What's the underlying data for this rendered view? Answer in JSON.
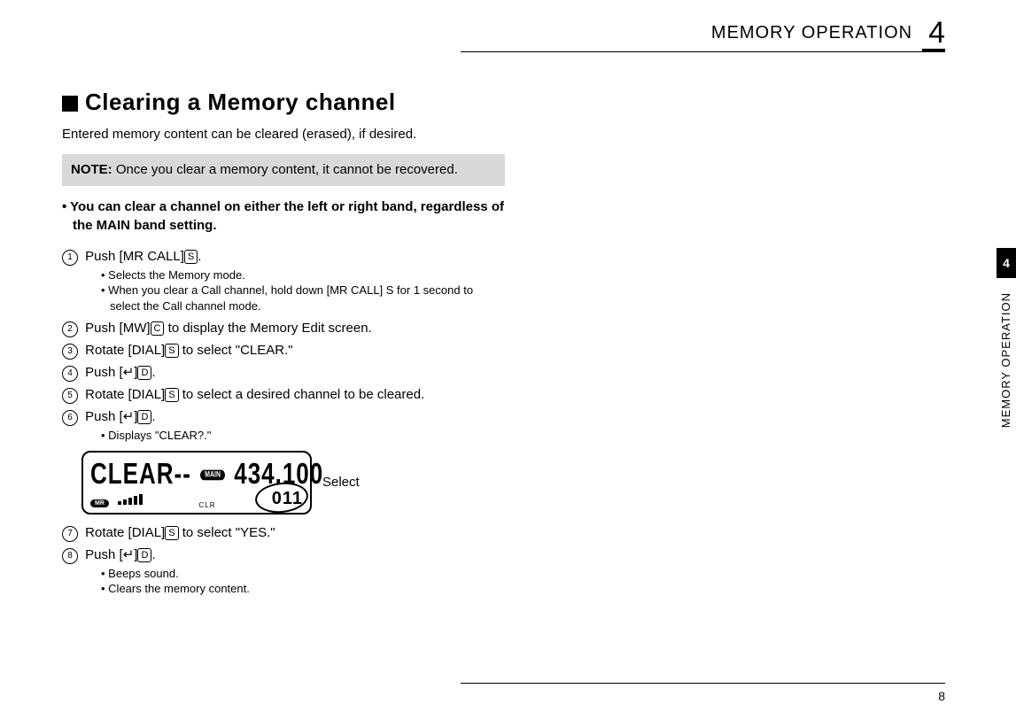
{
  "header": {
    "section_title": "MEMORY OPERATION",
    "chapter_number": "4"
  },
  "side": {
    "tab_number": "4",
    "vertical_label": "MEMORY OPERATION"
  },
  "page_number": "8",
  "content": {
    "title": "Clearing a Memory channel",
    "intro": "Entered memory content can be cleared (erased), if desired.",
    "note_label": "NOTE:",
    "note_text": "Once you clear a memory content, it cannot be recovered.",
    "lead_bullet": "• You can clear a channel on either the left or right band, regardless of the MAIN band setting.",
    "steps": {
      "s1": {
        "num": "1",
        "pre": "Push [MR CALL]",
        "key": "S",
        "post": ".",
        "sub": [
          "Selects the Memory mode.",
          "When you clear a Call channel, hold down [MR CALL] S  for 1 second to select the Call channel mode."
        ]
      },
      "s2": {
        "num": "2",
        "pre": "Push [MW]",
        "key": "C",
        "post": " to display the Memory Edit screen."
      },
      "s3": {
        "num": "3",
        "pre": "Rotate [DIAL]",
        "key": "S",
        "post": " to select \"CLEAR.\""
      },
      "s4": {
        "num": "4",
        "pre": "Push [↵]",
        "key": "D",
        "post": "."
      },
      "s5": {
        "num": "5",
        "pre": "Rotate [DIAL]",
        "key": "S",
        "post": " to select a desired channel to be cleared."
      },
      "s6": {
        "num": "6",
        "pre": "Push [↵]",
        "key": "D",
        "post": ".",
        "sub": [
          "Displays \"CLEAR?.\""
        ]
      },
      "s7": {
        "num": "7",
        "pre": "Rotate [DIAL]",
        "key": "S",
        "post": " to select \"YES.\""
      },
      "s8": {
        "num": "8",
        "pre": "Push [↵]",
        "key": "D",
        "post": ".",
        "sub": [
          "Beeps sound.",
          "Clears the memory content."
        ]
      }
    },
    "lcd": {
      "text_left": "CLEAR--",
      "main_badge": "MAIN",
      "freq": "434.100",
      "mr_badge": "MR",
      "clr_label": "CLR",
      "channel": "011",
      "select_label": "Select"
    }
  }
}
